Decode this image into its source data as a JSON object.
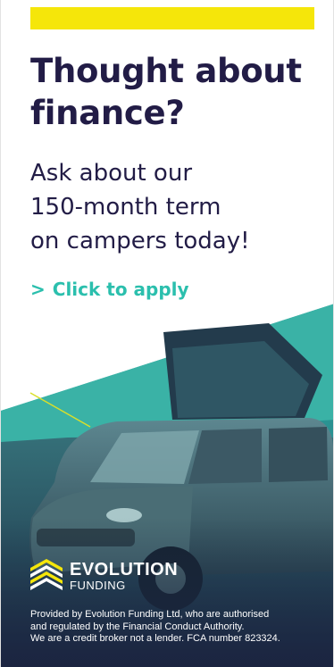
{
  "ad": {
    "headline_line1": "Thought about",
    "headline_line2": "finance?",
    "subhead_line1": "Ask about our",
    "subhead_line2": "150-month term",
    "subhead_line3": "on campers today!",
    "cta_chevron": ">",
    "cta_label": "Click to apply",
    "brand_name": "EVOLUTION",
    "brand_sub": "FUNDING",
    "disclaimer_line1": "Provided by Evolution Funding Ltd, who are authorised",
    "disclaimer_line2": "and regulated by the Financial Conduct Authority.",
    "disclaimer_line3": "We are a credit broker not a lender. FCA number 823324."
  },
  "colors": {
    "accent_yellow": "#f5e60a",
    "headline_navy": "#221c46",
    "cta_teal": "#2bbfad",
    "background": "#ffffff"
  },
  "icons": {
    "brand_mark": "evolution-logo-icon"
  }
}
